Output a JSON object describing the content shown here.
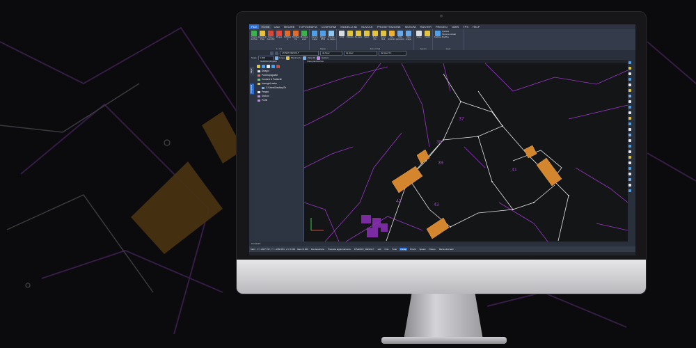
{
  "menu": [
    "FILE",
    "HOME",
    "CAD",
    "MISURE",
    "TOPOGRAFIA",
    "CONFORMI",
    "MODELLI 3D",
    "NUVOLE",
    "PROGETTAZIONE",
    "SEZIONI",
    "RASTER",
    "PREGEO",
    "GMIS",
    "TPS",
    "HELP"
  ],
  "ribbon_groups": [
    {
      "title": "In / Out",
      "buttons": [
        {
          "label": "Importa da Pfast",
          "color": "#3bb34a"
        },
        {
          "label": "Esporta in Pfast",
          "color": "#e8c23a"
        },
        {
          "label": "Invia a AutoCAD",
          "color": "#d04a3c"
        },
        {
          "label": "Pregeo",
          "color": "#e0493c"
        },
        {
          "label": "Dxf/Dwg In",
          "color": "#e26b2a"
        },
        {
          "label": "Dxf/Dwg Out",
          "color": "#e26b2a"
        },
        {
          "label": "Rivedere avvio",
          "color": "#3bb34a"
        }
      ]
    },
    {
      "title": "Mappe",
      "buttons": [
        {
          "label": "Genera mappe",
          "color": "#4fa0e8"
        },
        {
          "label": "Mappe WMS",
          "color": "#4fa0e8"
        },
        {
          "label": "Stampa su mappa",
          "color": "#8cc8f0"
        }
      ]
    },
    {
      "title": "Zoom / Vista",
      "buttons": [
        {
          "label": "Limiti",
          "color": "#d7dbe2"
        },
        {
          "label": "Finestra",
          "color": "#e2c440"
        },
        {
          "label": "Su punto",
          "color": "#e2c440"
        },
        {
          "label": "Selez.",
          "color": "#e2c440"
        },
        {
          "label": "Zoom Pre.",
          "color": "#e2c440"
        },
        {
          "label": "Zoom Mod.",
          "color": "#e2c440"
        },
        {
          "label": "Pan dinamico",
          "color": "#f0b030"
        },
        {
          "label": "Vista panoramica",
          "color": "#6aa8e8"
        },
        {
          "label": "Vista mappe",
          "color": "#6aa8e8"
        }
      ]
    },
    {
      "title": "Appunti",
      "buttons": [
        {
          "label": "Copia",
          "color": "#d7dbe2"
        },
        {
          "label": "Incolla",
          "color": "#e2c440"
        }
      ]
    },
    {
      "title": "Layer",
      "buttons": [
        {
          "label": "Gestione",
          "color": "#4fa0e8"
        }
      ],
      "extra": [
        "Quantità",
        "Sposta su attuale",
        "Modifica"
      ]
    }
  ],
  "layer_row": {
    "current_layer": "LAYER_DEFAULT",
    "color_value": "da layer",
    "linetype_value": "da layer",
    "lineweight_value": "da layer 0.1"
  },
  "view_row": {
    "scale_label": "Scala",
    "scale_value": "1:200",
    "linea_label": "Linea",
    "planimetria_label": "Planimetria",
    "vista3d_label": "Vista 3D",
    "sezioni_label": "Sezioni"
  },
  "side_tabs": [
    "Layer",
    "Proprietà"
  ],
  "panel_title": "Gestione progetto",
  "tree": [
    {
      "label": "Disegni",
      "color": "#e6e9ef",
      "indent": 0
    },
    {
      "label": "Punti topografici",
      "color": "#e26b6b",
      "indent": 0
    },
    {
      "label": "Contorni & Particelle",
      "color": "#6bd06b",
      "indent": 0
    },
    {
      "label": "Immagini raster",
      "color": "#e2c440",
      "indent": 0
    },
    {
      "label": "C:\\Users\\Desktop\\Te",
      "color": "#7ab0e8",
      "indent": 1
    },
    {
      "label": "Pregeo",
      "color": "#e6e9ef",
      "indent": 0
    },
    {
      "label": "Sezioni",
      "color": "#c48ae8",
      "indent": 0
    },
    {
      "label": "Profili",
      "color": "#c48ae8",
      "indent": 0
    }
  ],
  "canvas_tab": "Vista planimetrica",
  "parcel_labels": [
    "37",
    "38",
    "39",
    "41",
    "42",
    "43"
  ],
  "colors": {
    "drawing_line": "#9a38c8",
    "parcel_line": "#e6e6e6",
    "building": "#d4862e"
  },
  "command_label": "Comando:",
  "status": {
    "units": "Metri",
    "coords": "X = 2027.732 , Y = -1966.991 , Z = 0.000",
    "elev": "Elev.=0.000",
    "items": [
      "Da elevazione",
      "Proposta aggiornamento",
      "DISEGNO_DEFAULT",
      "edit",
      "Orto",
      "Polar",
      "Osnap",
      "Pinotti",
      "Spessi",
      "Param.",
      "Barra strumenti"
    ],
    "active_index": 6
  }
}
